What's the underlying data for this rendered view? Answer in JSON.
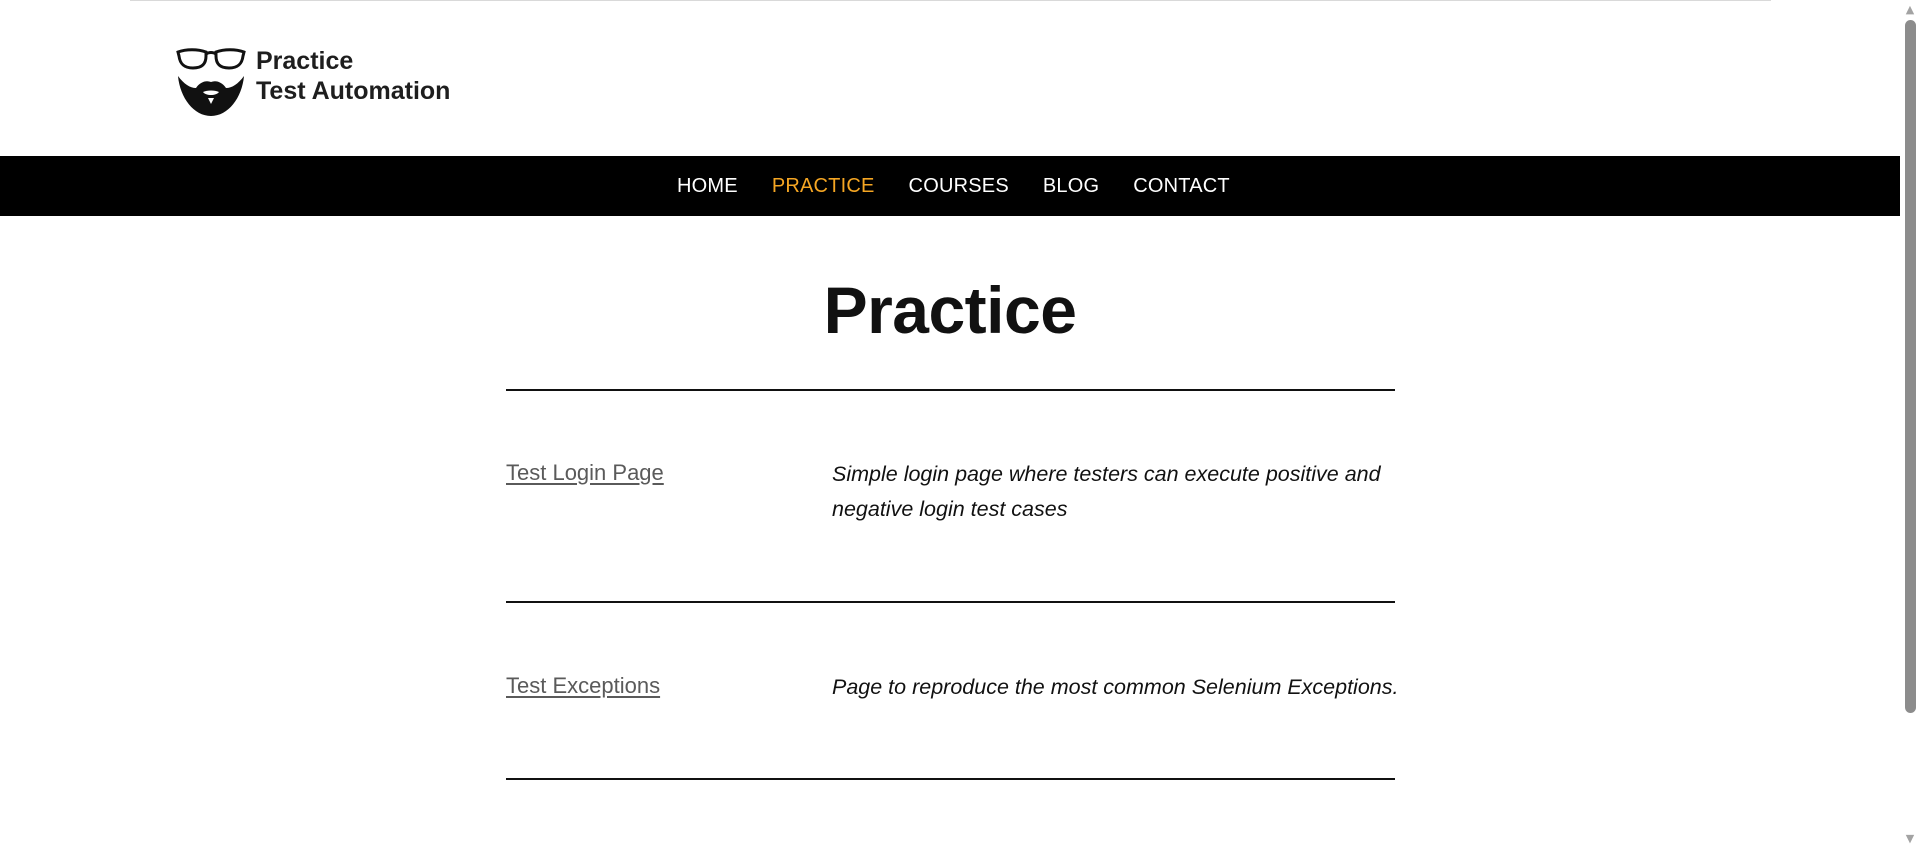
{
  "header": {
    "logo_line1": "Practice",
    "logo_line2": "Test Automation",
    "logo_icon": "glasses-beard-icon"
  },
  "nav": {
    "items": [
      {
        "label": "HOME",
        "active": false
      },
      {
        "label": "PRACTICE",
        "active": true
      },
      {
        "label": "COURSES",
        "active": false
      },
      {
        "label": "BLOG",
        "active": false
      },
      {
        "label": "CONTACT",
        "active": false
      }
    ],
    "active_color": "#f5a623",
    "background": "#000000"
  },
  "main": {
    "title": "Practice",
    "rows": [
      {
        "link": "Test Login Page",
        "description": "Simple login page where testers can execute positive and negative login test cases"
      },
      {
        "link": "Test Exceptions",
        "description": "Page to reproduce the most common Selenium Exceptions."
      }
    ]
  },
  "scrollbar": {
    "up_icon": "scroll-up-arrow-icon",
    "down_icon": "scroll-down-arrow-icon"
  }
}
